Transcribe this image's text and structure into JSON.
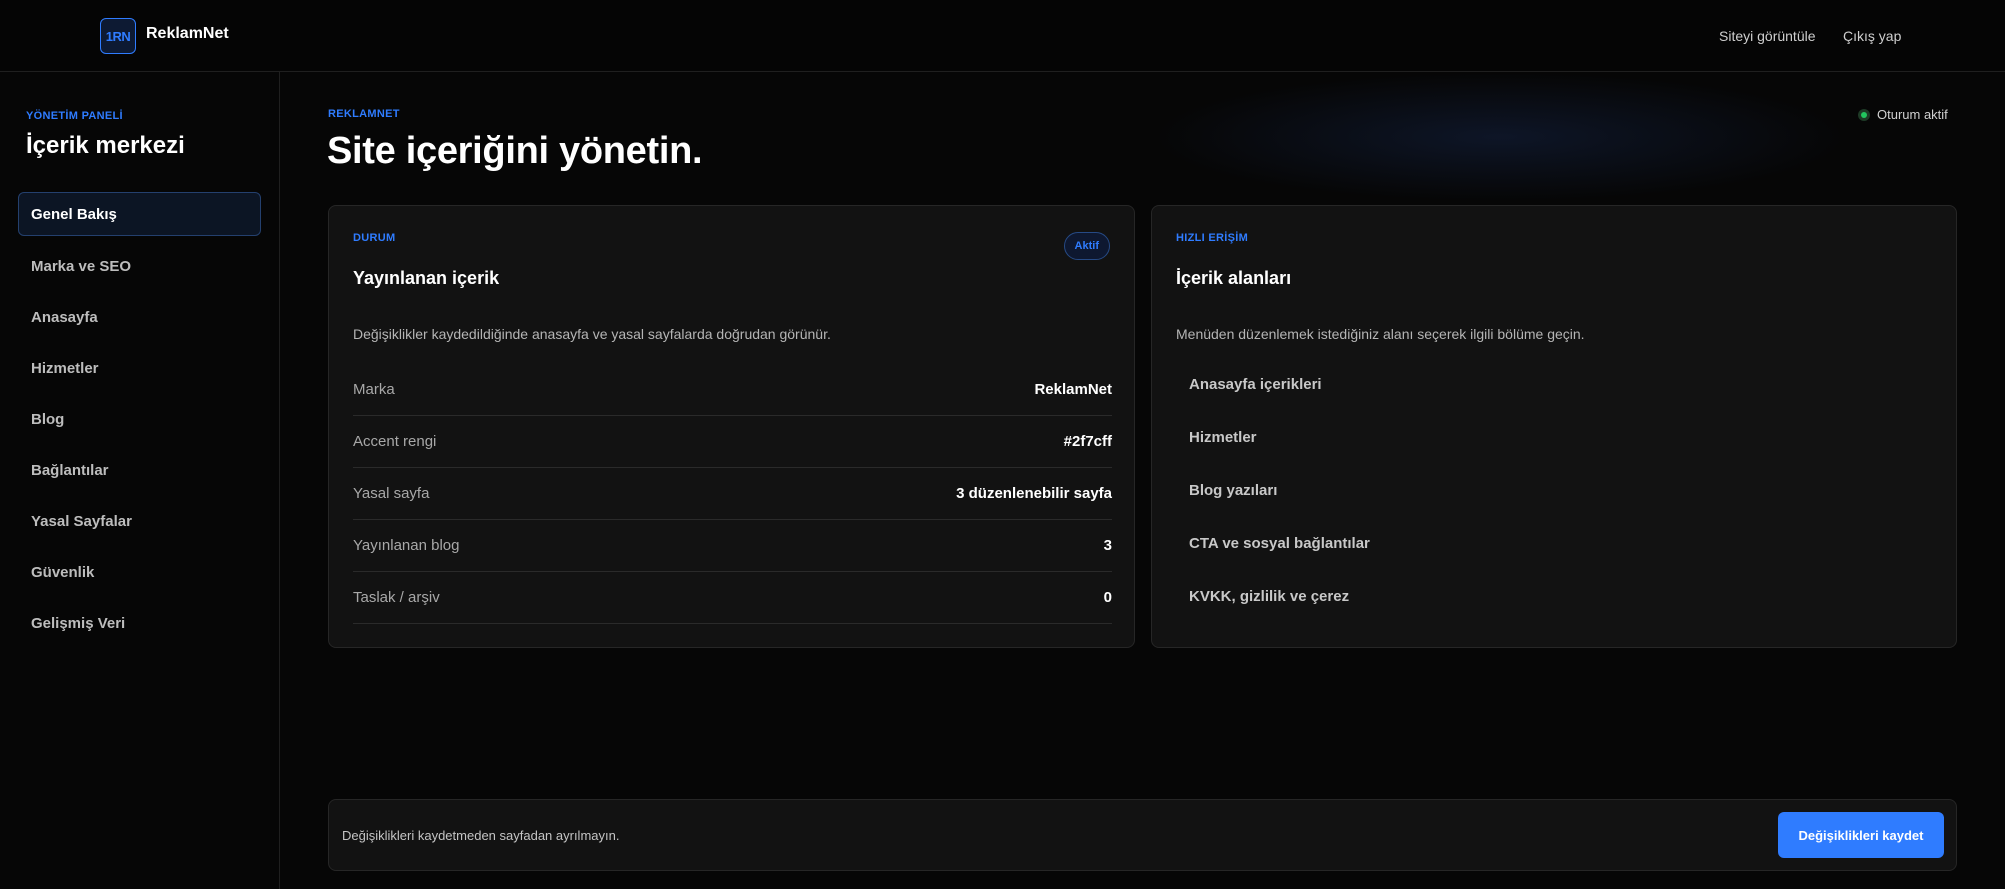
{
  "topbar": {
    "logo_text": "1RN",
    "brand": "ReklamNet",
    "view_site": "Siteyi görüntüle",
    "logout": "Çıkış yap"
  },
  "sidebar": {
    "eyebrow": "YÖNETİM PANELİ",
    "title": "İçerik merkezi",
    "items": [
      {
        "label": "Genel Bakış",
        "active": true
      },
      {
        "label": "Marka ve SEO"
      },
      {
        "label": "Anasayfa"
      },
      {
        "label": "Hizmetler"
      },
      {
        "label": "Blog"
      },
      {
        "label": "Bağlantılar"
      },
      {
        "label": "Yasal Sayfalar"
      },
      {
        "label": "Güvenlik"
      },
      {
        "label": "Gelişmiş Veri"
      }
    ]
  },
  "main": {
    "eyebrow": "REKLAMNET",
    "title": "Site içeriğini yönetin.",
    "session": "Oturum aktif"
  },
  "status_card": {
    "eyebrow": "DURUM",
    "badge": "Aktif",
    "title": "Yayınlanan içerik",
    "description": "Değişiklikler kaydedildiğinde anasayfa ve yasal sayfalarda doğrudan görünür.",
    "rows": [
      {
        "label": "Marka",
        "value": "ReklamNet"
      },
      {
        "label": "Accent rengi",
        "value": "#2f7cff"
      },
      {
        "label": "Yasal sayfa",
        "value": "3 düzenlenebilir sayfa"
      },
      {
        "label": "Yayınlanan blog",
        "value": "3"
      },
      {
        "label": "Taslak / arşiv",
        "value": "0"
      }
    ]
  },
  "quick_card": {
    "eyebrow": "HIZLI ERİŞİM",
    "title": "İçerik alanları",
    "description": "Menüden düzenlemek istediğiniz alanı seçerek ilgili bölüme geçin.",
    "items": [
      "Anasayfa içerikleri",
      "Hizmetler",
      "Blog yazıları",
      "CTA ve sosyal bağlantılar",
      "KVKK, gizlilik ve çerez"
    ]
  },
  "footer": {
    "warning": "Değişiklikleri kaydetmeden sayfadan ayrılmayın.",
    "save_label": "Değişiklikleri kaydet"
  },
  "colors": {
    "accent": "#2f7cff",
    "success": "#22c55e",
    "background": "#060606"
  }
}
